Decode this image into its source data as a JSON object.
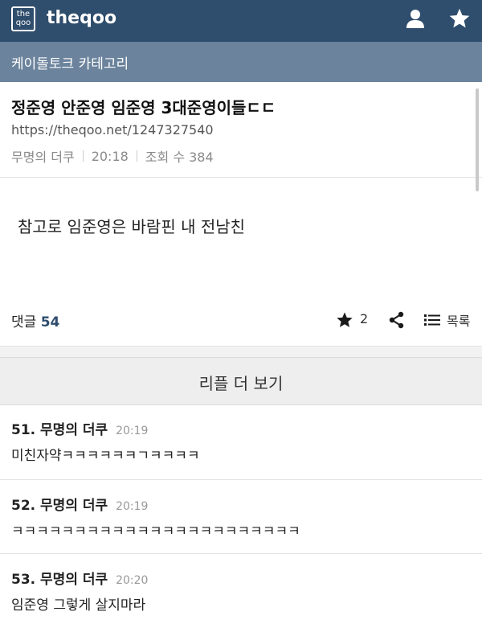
{
  "header": {
    "logo_text": "the qoo",
    "site_name": "theqoo"
  },
  "category": {
    "label": "케이돌토크 카테고리"
  },
  "post": {
    "title": "정준영 안준영 임준영 3대준영이들ㄷㄷ",
    "url": "https://theqoo.net/1247327540",
    "author": "무명의 더쿠",
    "time": "20:18",
    "views_label": "조회 수 384",
    "body": "참고로 임준영은 바람핀 내 전남친"
  },
  "actions": {
    "comment_label": "댓글",
    "comment_count": "54",
    "star_count": "2",
    "list_label": "목록"
  },
  "more_button": {
    "label": "리플 더 보기"
  },
  "comments": [
    {
      "number": "51.",
      "author": "무명의 더쿠",
      "time": "20:19",
      "text": "미친자약ㅋㅋㅋㅋㅋㅋㄱㅋㅋㅋㅋ"
    },
    {
      "number": "52.",
      "author": "무명의 더쿠",
      "time": "20:19",
      "text": "ㅋㅋㅋㅋㅋㅋㅋㅋㅋㅋㅋㅋㅋㅋㅋㅋㅋㅋㅋㅋㅋㅋㅋ"
    },
    {
      "number": "53.",
      "author": "무명의 더쿠",
      "time": "20:20",
      "text": "임준영 그렇게 살지마라"
    }
  ],
  "colors": {
    "header_bg": "#2f4d6c",
    "category_bg": "#6b839c",
    "accent": "#2f4d6c"
  }
}
